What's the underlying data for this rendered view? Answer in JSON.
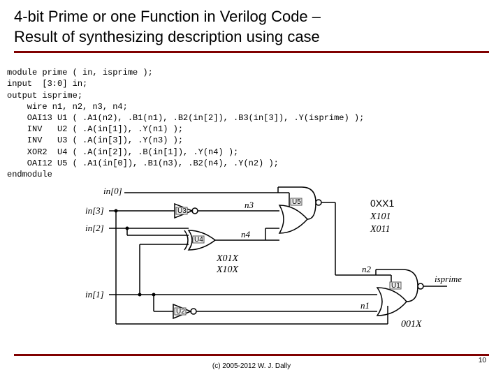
{
  "title_line1": "4-bit Prime or one Function in Verilog Code –",
  "title_line2": "Result of synthesizing description using case",
  "code": "module prime ( in, isprime );\ninput  [3:0] in;\noutput isprime;\n    wire n1, n2, n3, n4;\n    OAI13 U1 ( .A1(n2), .B1(n1), .B2(in[2]), .B3(in[3]), .Y(isprime) );\n    INV   U2 ( .A(in[1]), .Y(n1) );\n    INV   U3 ( .A(in[3]), .Y(n3) );\n    XOR2  U4 ( .A(in[2]), .B(in[1]), .Y(n4) );\n    OAI12 U5 ( .A1(in[0]), .B1(n3), .B2(n4), .Y(n2) );\nendmodule",
  "signals": {
    "in0": "in[0]",
    "in1": "in[1]",
    "in2": "in[2]",
    "in3": "in[3]",
    "n1": "n1",
    "n2": "n2",
    "n3": "n3",
    "n4": "n4",
    "out": "isprime"
  },
  "gates": {
    "u1": "U1",
    "u2": "U2",
    "u3": "U3",
    "u4": "U4",
    "u5": "U5"
  },
  "annotations": {
    "group1a": "0XX1",
    "group1b": "X101",
    "group1c": "X011",
    "group2a": "X01X",
    "group2b": "X10X",
    "group3": "001X"
  },
  "footer": "(c) 2005-2012 W. J. Dally",
  "page": "10"
}
